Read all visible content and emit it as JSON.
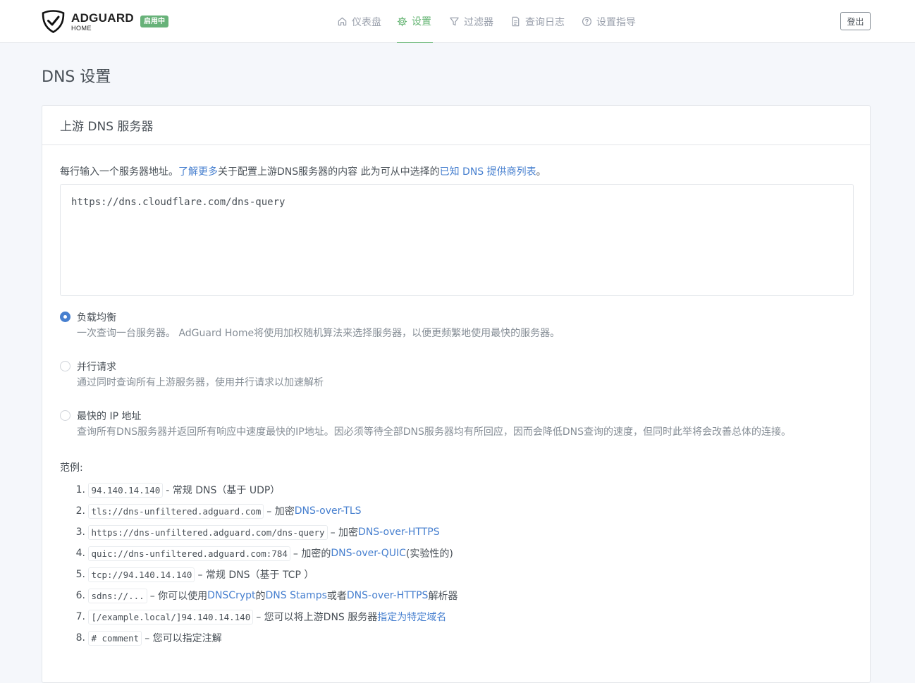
{
  "header": {
    "brand_name": "ADGUARD",
    "brand_sub": "HOME",
    "status_badge": "启用中",
    "nav": [
      {
        "label": "仪表盘",
        "icon": "home-icon"
      },
      {
        "label": "设置",
        "icon": "gear-icon",
        "active": true
      },
      {
        "label": "过滤器",
        "icon": "filter-icon"
      },
      {
        "label": "查询日志",
        "icon": "document-icon"
      },
      {
        "label": "设置指导",
        "icon": "help-circle-icon"
      }
    ],
    "logout_label": "登出",
    "accent_color": "#66b574"
  },
  "page": {
    "title": "DNS 设置"
  },
  "upstream": {
    "card_title": "上游 DNS 服务器",
    "hint_prefix": "每行输入一个服务器地址。",
    "hint_link1": "了解更多",
    "hint_middle": "关于配置上游DNS服务器的内容 此为可从中选择的",
    "hint_link2": "已知 DNS 提供商列表",
    "hint_suffix": "。",
    "textarea_value": "https://dns.cloudflare.com/dns-query",
    "modes": [
      {
        "label": "负载均衡",
        "desc": "一次查询一台服务器。 AdGuard Home将使用加权随机算法来选择服务器，以便更频繁地使用最快的服务器。",
        "checked": true
      },
      {
        "label": "并行请求",
        "desc": "通过同时查询所有上游服务器，使用并行请求以加速解析",
        "checked": false
      },
      {
        "label": "最快的 IP 地址",
        "desc": "查询所有DNS服务器并返回所有响应中速度最快的IP地址。因必须等待全部DNS服务器均有所回应，因而会降低DNS查询的速度，但同时此举将会改善总体的连接。",
        "checked": false
      }
    ],
    "examples_title": "范例:",
    "examples": [
      {
        "num": "1.",
        "code": "94.140.14.140",
        "text1": " - 常规 DNS（基于 UDP）",
        "link": "",
        "text2": ""
      },
      {
        "num": "2.",
        "code": "tls://dns-unfiltered.adguard.com",
        "text1": " – 加密 ",
        "link": "DNS-over-TLS",
        "text2": ""
      },
      {
        "num": "3.",
        "code": "https://dns-unfiltered.adguard.com/dns-query",
        "text1": " – 加密 ",
        "link": "DNS-over-HTTPS",
        "text2": ""
      },
      {
        "num": "4.",
        "code": "quic://dns-unfiltered.adguard.com:784",
        "text1": " – 加密的",
        "link": "DNS-over-QUIC",
        "text2": " (实验性的)"
      },
      {
        "num": "5.",
        "code": "tcp://94.140.14.140",
        "text1": " – 常规 DNS（基于 TCP ）",
        "link": "",
        "text2": ""
      },
      {
        "num": "6.",
        "code": "sdns://...",
        "text1": " – 你可以使用 ",
        "link": "DNSCrypt",
        "text2": " 的 ",
        "link2": "DNS Stamps",
        "text3": " 或者 ",
        "link3": "DNS-over-HTTPS",
        "text4": " 解析器"
      },
      {
        "num": "7.",
        "code": "[/example.local/]94.140.14.140",
        "text1": " – 您可以将上游DNS 服务器",
        "link": "指定为特定域名",
        "text2": ""
      },
      {
        "num": "8.",
        "code": "# comment",
        "text1": " – 您可以指定注解",
        "link": "",
        "text2": ""
      }
    ]
  }
}
